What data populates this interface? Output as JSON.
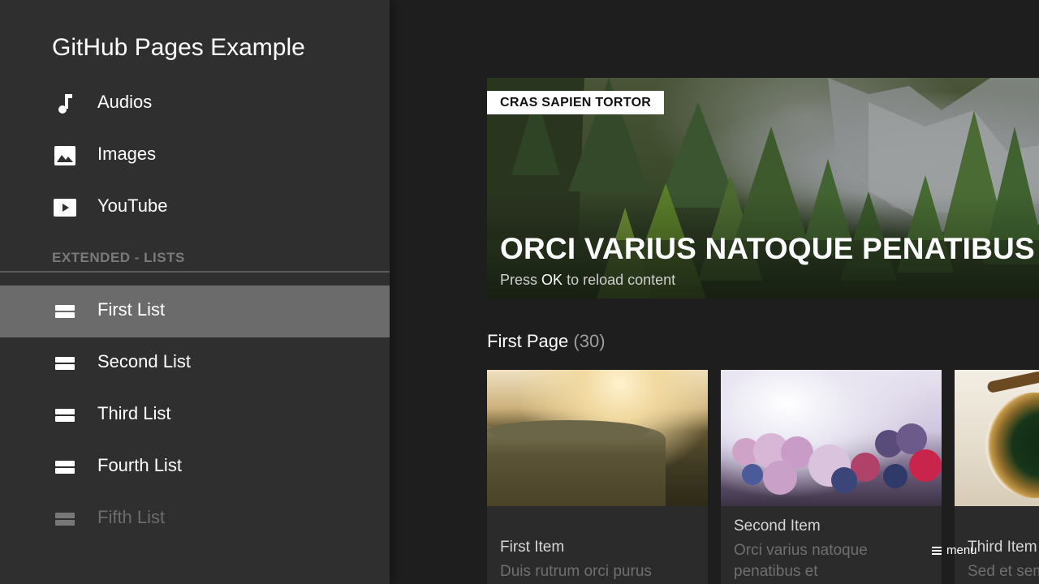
{
  "sidebar": {
    "title": "GitHub Pages Example",
    "items": [
      {
        "label": "Audios",
        "icon": "music-note-icon"
      },
      {
        "label": "Images",
        "icon": "image-icon"
      },
      {
        "label": "YouTube",
        "icon": "play-icon"
      }
    ],
    "section_label": "EXTENDED - LISTS",
    "lists": [
      {
        "label": "First List",
        "icon": "list-icon",
        "selected": true
      },
      {
        "label": "Second List",
        "icon": "list-icon"
      },
      {
        "label": "Third List",
        "icon": "list-icon"
      },
      {
        "label": "Fourth List",
        "icon": "list-icon"
      },
      {
        "label": "Fifth List",
        "icon": "list-icon"
      }
    ]
  },
  "hero": {
    "tag": "CRAS SAPIEN TORTOR",
    "title": "ORCI VARIUS NATOQUE PENATIBUS",
    "hint_press": "Press",
    "hint_key": "OK",
    "hint_rest": "to reload content"
  },
  "section": {
    "title": "First Page",
    "count": "(30)"
  },
  "cards": [
    {
      "title": "First Item",
      "desc": "Duis rutrum orci purus"
    },
    {
      "title": "Second Item",
      "desc": "Orci varius natoque penatibus et"
    },
    {
      "title": "Third Item",
      "desc": "Sed et sem"
    }
  ],
  "menu_hint": {
    "label": "menu",
    "icon": "hamburger-icon"
  },
  "colors": {
    "sidebar_bg": "#2f2f2f",
    "selected_bg": "#6b6b6b",
    "main_bg": "#1e1e1e",
    "card_bg": "#2b2b2b"
  }
}
